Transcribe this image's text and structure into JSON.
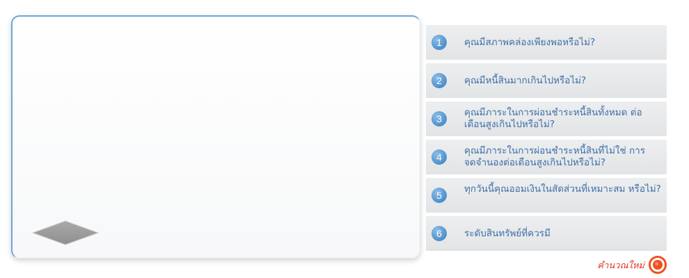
{
  "questions": [
    {
      "number": "1",
      "text": "คุณมีสภาพคล่องเพียงพอหรือไม่?"
    },
    {
      "number": "2",
      "text": "คุณมีหนี้สินมากเกินไปหรือไม่?"
    },
    {
      "number": "3",
      "text": "คุณมีภาระในการผ่อนชำระหนี้สินทั้งหมด ต่อเดือนสูงเกินไปหรือไม่?"
    },
    {
      "number": "4",
      "text": "คุณมีภาระในการผ่อนชำระหนี้สินที่ไม่ใช่ การจดจำนองต่อเดือนสูงเกินไปหรือไม่?"
    },
    {
      "number": "5",
      "text": "ทุกวันนี้คุณออมเงินในสัดส่วนที่เหมาะสม หรือไม่?"
    },
    {
      "number": "6",
      "text": "ระดับสินทรัพย์ที่ควรมี"
    }
  ],
  "footer": {
    "label": "คำนวณใหม่",
    "icon": "target-icon"
  },
  "colors": {
    "accent_blue": "#4d8fcb",
    "question_text": "#3f6fa8",
    "item_bg": "#e6e8ea",
    "footer_orange": "#f0501e"
  }
}
